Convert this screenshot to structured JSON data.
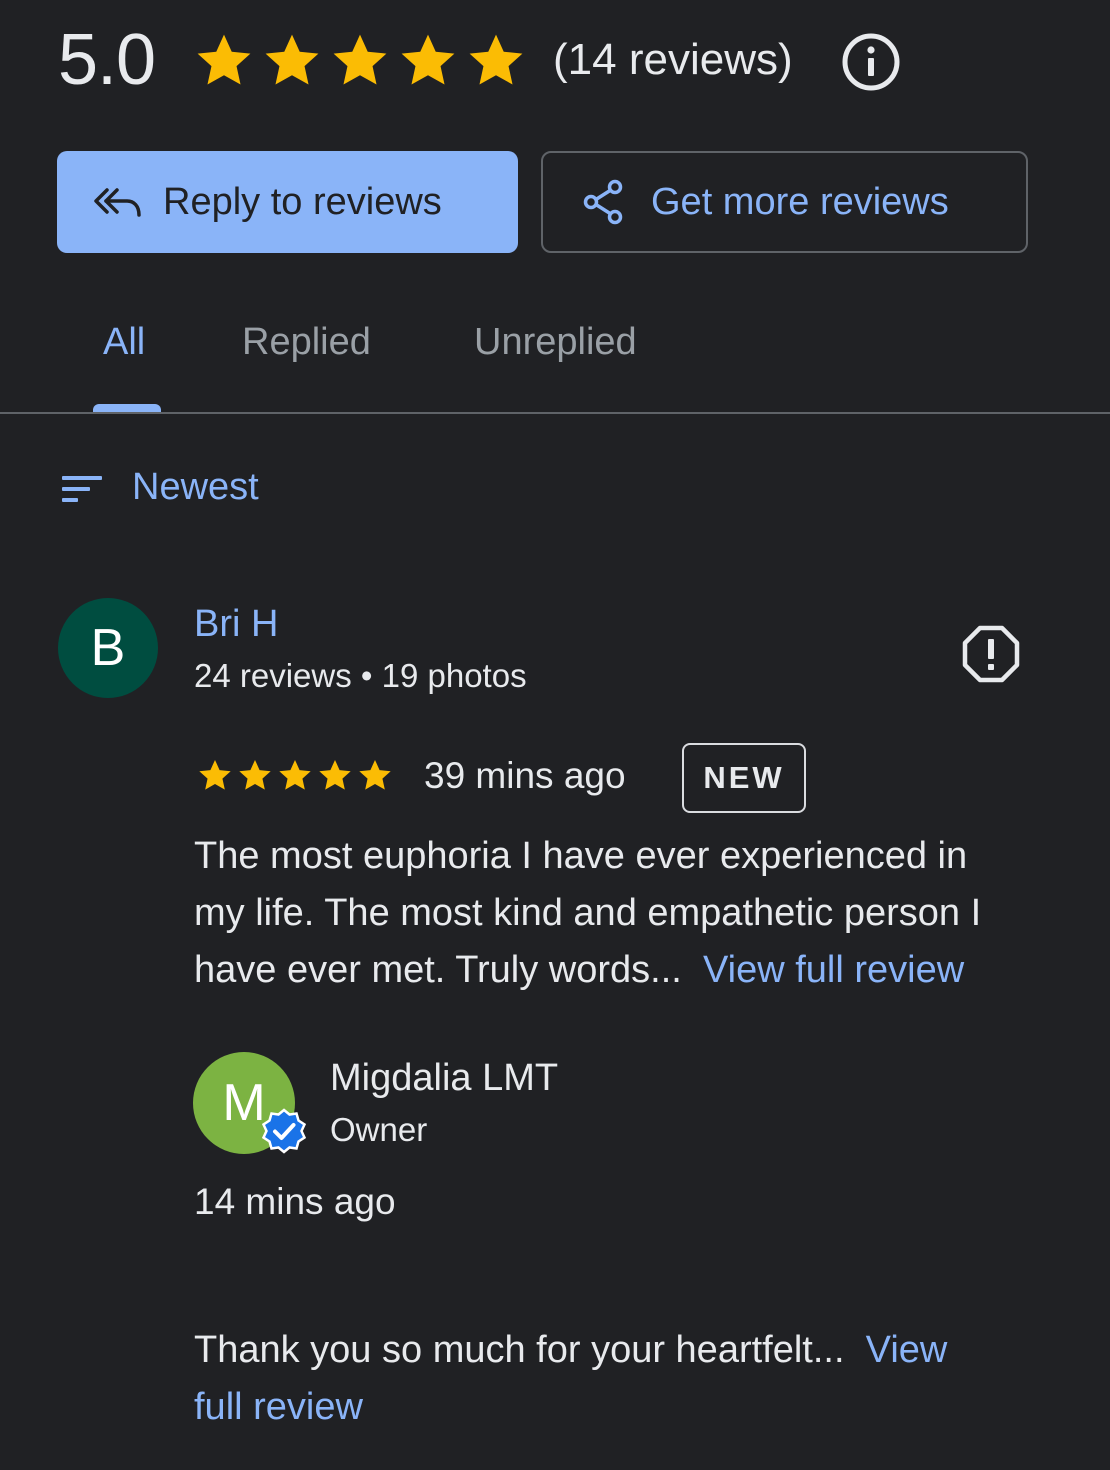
{
  "summary": {
    "rating": "5.0",
    "star_count": 5,
    "review_count": "(14 reviews)"
  },
  "actions": {
    "reply_label": "Reply to reviews",
    "get_more_label": "Get more reviews"
  },
  "tabs": [
    {
      "label": "All",
      "selected": true
    },
    {
      "label": "Replied",
      "selected": false
    },
    {
      "label": "Unreplied",
      "selected": false
    }
  ],
  "sort": {
    "label": "Newest"
  },
  "review": {
    "avatar_letter": "B",
    "name": "Bri H",
    "meta": "24 reviews • 19 photos",
    "stars": 5,
    "time": "39 mins ago",
    "badge": "NEW",
    "text_lines": [
      "The most euphoria I have ever experienced in",
      "my life. The most kind and empathetic person I",
      "have ever met. Truly words..."
    ],
    "view_full_label": "View full review"
  },
  "owner_reply": {
    "avatar_letter": "M",
    "name": "Migdalia LMT",
    "role": "Owner",
    "time": "14 mins ago",
    "text_line1": "Thank you so much for your heartfelt...",
    "view_label_part1": "View",
    "view_label_part2": "full review"
  },
  "colors": {
    "background": "#202124",
    "accent": "#8ab4f8",
    "star": "#fbbc04",
    "avatar_b": "#004d40",
    "avatar_m": "#7cb342",
    "verified": "#1a73e8"
  },
  "icons": {
    "info": "info-icon",
    "reply": "reply-all-icon",
    "share": "share-icon",
    "sort": "sort-icon",
    "report": "report-icon",
    "verified": "verified-badge-icon",
    "star": "star-icon"
  }
}
